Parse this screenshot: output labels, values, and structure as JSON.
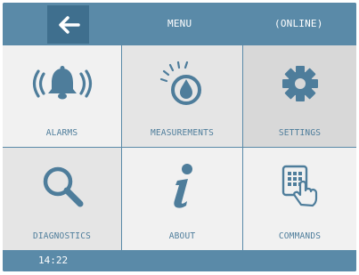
{
  "header": {
    "menu_label": "MENU",
    "status_label": "(ONLINE)",
    "back_icon": "arrow-left-icon"
  },
  "tiles": [
    {
      "label": "ALARMS",
      "icon": "bell-ringing-icon"
    },
    {
      "label": "MEASUREMENTS",
      "icon": "drop-gauge-icon"
    },
    {
      "label": "SETTINGS",
      "icon": "gear-icon"
    },
    {
      "label": "DIAGNOSTICS",
      "icon": "magnifier-icon"
    },
    {
      "label": "ABOUT",
      "icon": "info-icon"
    },
    {
      "label": "COMMANDS",
      "icon": "keypad-touch-icon"
    }
  ],
  "footer": {
    "time": "14:22"
  },
  "colors": {
    "bar": "#5a8aa8",
    "back_button": "#3f6f8e",
    "icon": "#4e7d9b"
  }
}
